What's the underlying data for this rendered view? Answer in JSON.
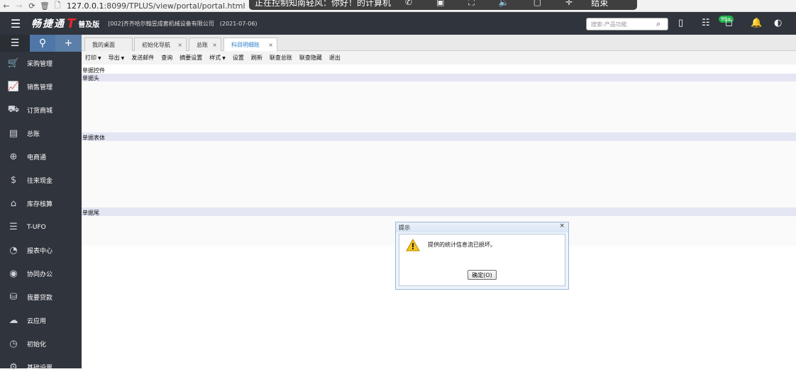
{
  "browser": {
    "url_host": "127.0.0.1",
    "url_rest": ":8099/TPLUS/view/portal/portal.html"
  },
  "remote_overlay": {
    "text": "正在控制知南轻风：你好！的计算机",
    "end_label": "结束"
  },
  "header": {
    "logo": "畅捷通",
    "logo_mark": "T",
    "edition": "普及版",
    "company": "[002]齐齐哈尔翰昱成套机械设备有限公司",
    "date": "(2021-07-06)",
    "search_placeholder": "搜索-产品功能",
    "badge": "99+"
  },
  "sidebar": {
    "items": [
      {
        "label": "采购管理",
        "icon": "cart-icon"
      },
      {
        "label": "销售管理",
        "icon": "chart-icon"
      },
      {
        "label": "订货商城",
        "icon": "shop-icon"
      },
      {
        "label": "总账",
        "icon": "ledger-icon"
      },
      {
        "label": "电商通",
        "icon": "ecommerce-icon"
      },
      {
        "label": "往来现金",
        "icon": "dollar-icon"
      },
      {
        "label": "库存核算",
        "icon": "warehouse-icon"
      },
      {
        "label": "T-UFO",
        "icon": "document-icon"
      },
      {
        "label": "报表中心",
        "icon": "pie-icon"
      },
      {
        "label": "协同办公",
        "icon": "target-icon"
      },
      {
        "label": "我要贷款",
        "icon": "coins-icon"
      },
      {
        "label": "云应用",
        "icon": "cloud-icon"
      },
      {
        "label": "初始化",
        "icon": "clock-icon"
      },
      {
        "label": "基础设置",
        "icon": "settings-icon"
      }
    ]
  },
  "tabs": [
    {
      "label": "我的桌面"
    },
    {
      "label": "初始化导航"
    },
    {
      "label": "总账"
    },
    {
      "label": "科目明细账"
    }
  ],
  "toolbar": {
    "items": [
      "打印",
      "导出",
      "发送邮件",
      "查询",
      "摘要设置",
      "样式",
      "设置",
      "刷新",
      "联查总账",
      "联查隐藏",
      "退出"
    ]
  },
  "content": {
    "control_label": "单据控件",
    "head_label": "单据头",
    "body_label": "单据表体",
    "tail_label": "单据尾"
  },
  "dialog": {
    "title": "提示",
    "message": "提供的统计信息流已损坏。",
    "ok_label": "确定(O)"
  }
}
